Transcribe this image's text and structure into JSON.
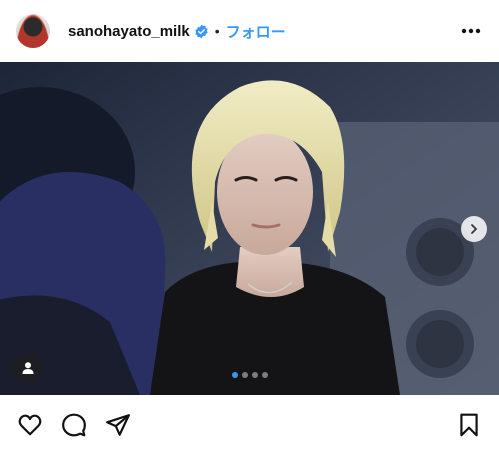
{
  "post": {
    "username": "sanohayato_milk",
    "follow_label": "フォロー",
    "separator": "•",
    "carousel": {
      "slide_count": 4,
      "active_index": 0
    }
  },
  "icons": {
    "avatar": "profile-avatar",
    "verified": "verified-badge-icon",
    "more": "more-options-icon",
    "next": "chevron-right-icon",
    "tag": "user-tag-icon",
    "like": "heart-icon",
    "comment": "comment-icon",
    "share": "paper-plane-icon",
    "save": "bookmark-icon"
  },
  "colors": {
    "link": "#3897f0",
    "verified": "#3897f0",
    "text": "#111111"
  }
}
